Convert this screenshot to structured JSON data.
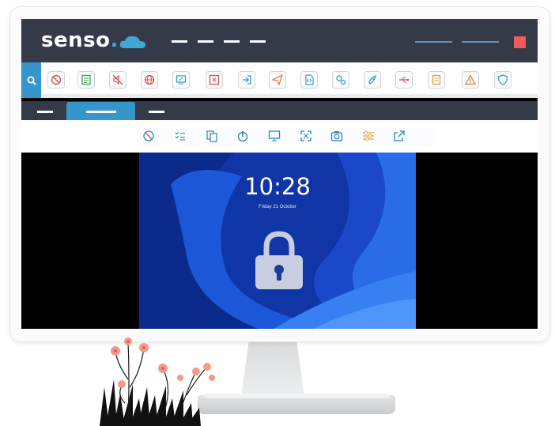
{
  "app": {
    "logo_text": "senso",
    "logo_dot": "."
  },
  "colors": {
    "header_bg": "#343a47",
    "accent_blue": "#3696c9",
    "close_red": "#f25a5a"
  },
  "toolbar": {
    "search_icon": "search-icon",
    "icons": [
      {
        "name": "block-icon",
        "color": "#e05252"
      },
      {
        "name": "checklist-icon",
        "color": "#3aa655"
      },
      {
        "name": "mute-icon",
        "color": "#e05252"
      },
      {
        "name": "globe-icon",
        "color": "#e05252"
      },
      {
        "name": "screen-share-icon",
        "color": "#3aa0c8"
      },
      {
        "name": "close-window-icon",
        "color": "#e05252"
      },
      {
        "name": "login-icon",
        "color": "#3aa0c8"
      },
      {
        "name": "send-icon",
        "color": "#e8803a"
      },
      {
        "name": "code-file-icon",
        "color": "#3aa0c8"
      },
      {
        "name": "settings-icon",
        "color": "#3aa0c8"
      },
      {
        "name": "rocket-icon",
        "color": "#3aa0c8"
      },
      {
        "name": "usb-icon",
        "color": "#e05252"
      },
      {
        "name": "document-icon",
        "color": "#e0a030"
      },
      {
        "name": "warning-icon",
        "color": "#e8803a"
      },
      {
        "name": "shield-icon",
        "color": "#3aa0c8"
      }
    ]
  },
  "actions": {
    "icons": [
      "disable-icon",
      "task-list-icon",
      "copy-icon",
      "power-icon",
      "monitor-icon",
      "fullscreen-icon",
      "camera-icon",
      "sliders-icon",
      "share-icon"
    ]
  },
  "lockscreen": {
    "time": "10:28",
    "date": "Friday 21 October"
  }
}
